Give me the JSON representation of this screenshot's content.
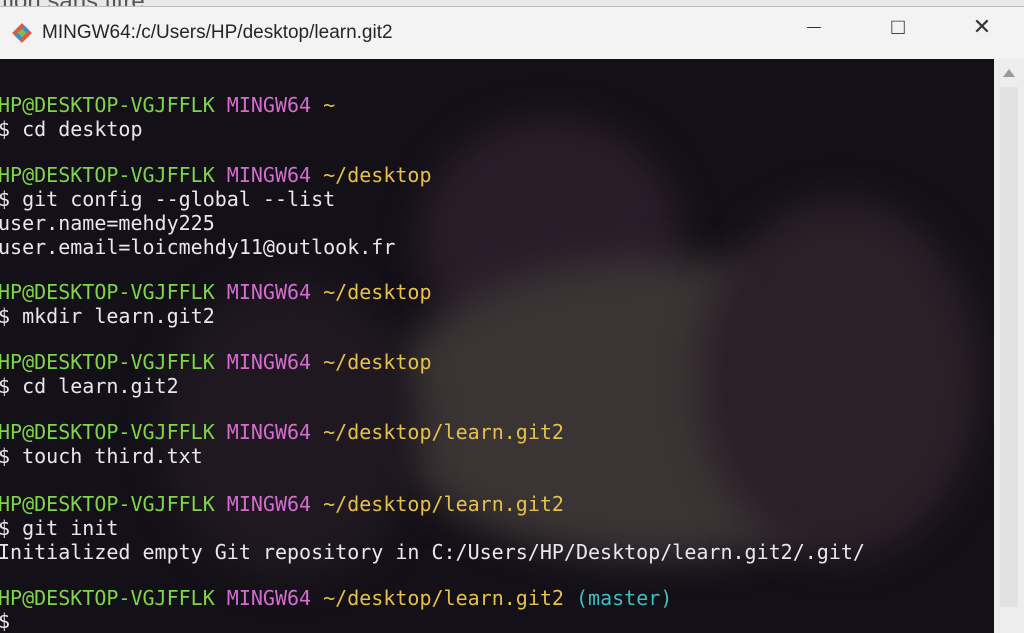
{
  "background_page": {
    "title_fragment": "tion sans titre"
  },
  "window": {
    "title": "MINGW64:/c/Users/HP/desktop/learn.git2",
    "icons": {
      "app": "git-diamond-icon",
      "minimize": "minimize-icon",
      "maximize": "maximize-icon",
      "close": "close-icon"
    },
    "controls": {
      "maximize_glyph": "□",
      "close_glyph": "✕"
    }
  },
  "terminal": {
    "colors": {
      "user": "#7ed54a",
      "shell": "#d56ccf",
      "path": "#e5c04a",
      "branch": "#3fbfc0",
      "text": "#e9e6ee",
      "background": "#141017"
    },
    "blocks": [
      {
        "user": "HP@DESKTOP-VGJFFLK",
        "shell": "MINGW64",
        "path": "~",
        "branch": "",
        "command": "$ cd desktop",
        "output": []
      },
      {
        "user": "HP@DESKTOP-VGJFFLK",
        "shell": "MINGW64",
        "path": "~/desktop",
        "branch": "",
        "command": "$ git config --global --list",
        "output": [
          "user.name=mehdy225",
          "user.email=loicmehdy11@outlook.fr"
        ]
      },
      {
        "user": "HP@DESKTOP-VGJFFLK",
        "shell": "MINGW64",
        "path": "~/desktop",
        "branch": "",
        "command": "$ mkdir learn.git2",
        "output": []
      },
      {
        "user": "HP@DESKTOP-VGJFFLK",
        "shell": "MINGW64",
        "path": "~/desktop",
        "branch": "",
        "command": "$ cd learn.git2",
        "output": []
      },
      {
        "user": "HP@DESKTOP-VGJFFLK",
        "shell": "MINGW64",
        "path": "~/desktop/learn.git2",
        "branch": "",
        "command": "$ touch third.txt",
        "output": []
      },
      {
        "user": "HP@DESKTOP-VGJFFLK",
        "shell": "MINGW64",
        "path": "~/desktop/learn.git2",
        "branch": "",
        "command": "$ git init",
        "output": [
          "Initialized empty Git repository in C:/Users/HP/Desktop/learn.git2/.git/"
        ]
      },
      {
        "user": "HP@DESKTOP-VGJFFLK",
        "shell": "MINGW64",
        "path": "~/desktop/learn.git2",
        "branch": "(master)",
        "command": "$",
        "output": []
      }
    ]
  }
}
